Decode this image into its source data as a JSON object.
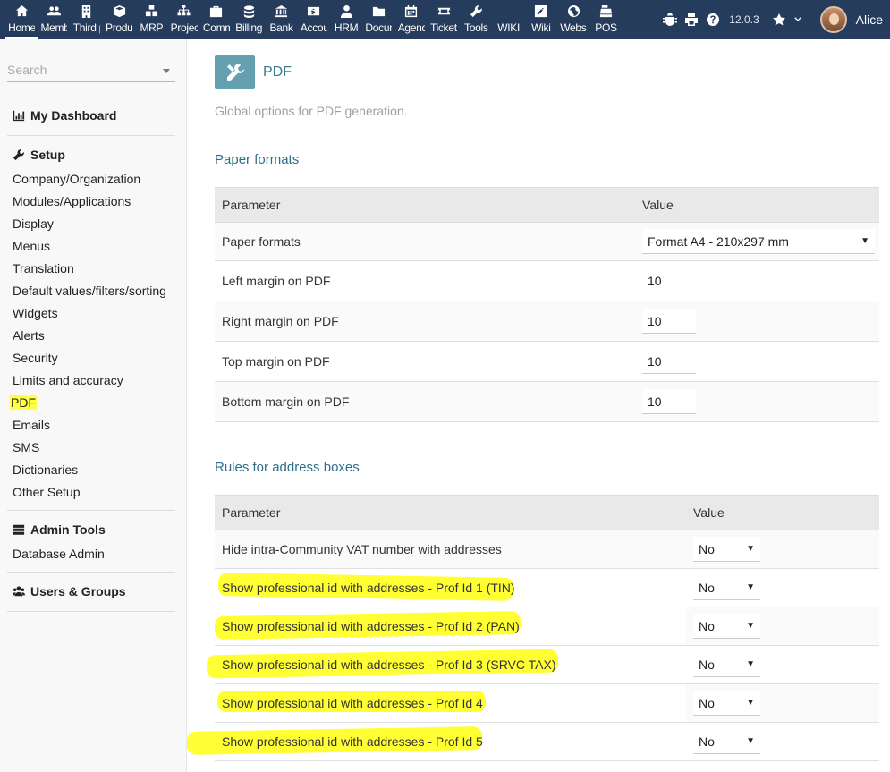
{
  "topbar": {
    "menus": [
      {
        "label": "Home",
        "icon": "home-icon",
        "active": true
      },
      {
        "label": "Members",
        "icon": "members-icon"
      },
      {
        "label": "Third parties",
        "icon": "building-icon"
      },
      {
        "label": "Products",
        "icon": "cube-icon"
      },
      {
        "label": "MRP",
        "icon": "cubes-icon"
      },
      {
        "label": "Projects",
        "icon": "sitemap-icon"
      },
      {
        "label": "Commerce",
        "icon": "suitcase-icon"
      },
      {
        "label": "Billing",
        "icon": "coins-icon"
      },
      {
        "label": "Bank",
        "icon": "bank-icon"
      },
      {
        "label": "Accounting",
        "icon": "dollar-icon"
      },
      {
        "label": "HRM",
        "icon": "user-tie-icon"
      },
      {
        "label": "Documents",
        "icon": "folder-icon"
      },
      {
        "label": "Agenda",
        "icon": "calendar-icon"
      },
      {
        "label": "Tickets",
        "icon": "ticket-icon"
      },
      {
        "label": "Tools",
        "icon": "wrench-icon"
      },
      {
        "label": "WIKI",
        "icon": "none"
      },
      {
        "label": "Wiki",
        "icon": "edit-icon"
      },
      {
        "label": "Website",
        "icon": "globe-icon"
      },
      {
        "label": "POS",
        "icon": "cash-register-icon"
      }
    ],
    "version": "12.0.3",
    "username": "Alice"
  },
  "sidebar": {
    "search_placeholder": "Search",
    "dashboard": "My Dashboard",
    "setup_title": "Setup",
    "setup_items": [
      "Company/Organization",
      "Modules/Applications",
      "Display",
      "Menus",
      "Translation",
      "Default values/filters/sorting",
      "Widgets",
      "Alerts",
      "Security",
      "Limits and accuracy",
      "PDF",
      "Emails",
      "SMS",
      "Dictionaries",
      "Other Setup"
    ],
    "admin_title": "Admin Tools",
    "admin_items": [
      "Database Admin"
    ],
    "users_title": "Users & Groups"
  },
  "main": {
    "title": "PDF",
    "description": "Global options for PDF generation.",
    "paper_section": {
      "title": "Paper formats",
      "col_param": "Parameter",
      "col_value": "Value",
      "format_label": "Paper formats",
      "format_value": "Format A4 - 210x297 mm",
      "margins": [
        {
          "label": "Left margin on PDF",
          "value": "10"
        },
        {
          "label": "Right margin on PDF",
          "value": "10"
        },
        {
          "label": "Top margin on PDF",
          "value": "10"
        },
        {
          "label": "Bottom margin on PDF",
          "value": "10"
        }
      ]
    },
    "address_section": {
      "title": "Rules for address boxes",
      "col_param": "Parameter",
      "col_value": "Value",
      "rows": [
        {
          "label": "Hide intra-Community VAT number with addresses",
          "value": "No"
        },
        {
          "label": "Show professional id with addresses - Prof Id 1 (TIN)",
          "value": "No"
        },
        {
          "label": "Show professional id with addresses - Prof Id 2 (PAN)",
          "value": "No"
        },
        {
          "label": "Show professional id with addresses - Prof Id 3 (SRVC TAX)",
          "value": "No"
        },
        {
          "label": "Show professional id with addresses - Prof Id 4",
          "value": "No"
        },
        {
          "label": "Show professional id with addresses - Prof Id 5",
          "value": "No"
        }
      ]
    }
  },
  "colors": {
    "topbar": "#263c5c",
    "accent": "#2d6f8a",
    "icon_bg": "#64a0b0",
    "highlight": "#ffff33"
  }
}
